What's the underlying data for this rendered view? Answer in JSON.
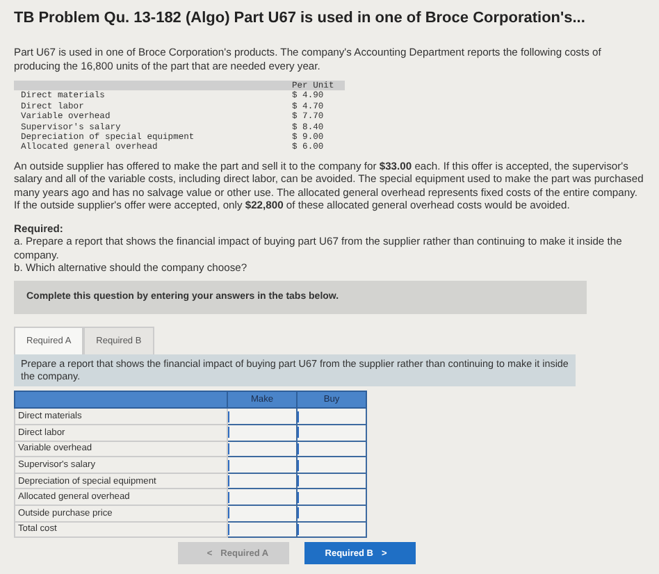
{
  "title": "TB Problem Qu. 13-182 (Algo) Part U67 is used in one of Broce Corporation's...",
  "intro": "Part U67 is used in one of Broce Corporation's products. The company's Accounting Department reports the following costs of producing the 16,800 units of the part that are needed every year.",
  "cost_table": {
    "header": "Per Unit",
    "rows": [
      {
        "label": "Direct materials",
        "value": "$ 4.90"
      },
      {
        "label": "Direct labor",
        "value": "$ 4.70"
      },
      {
        "label": "Variable overhead",
        "value": "$ 7.70"
      },
      {
        "label": "Supervisor's salary",
        "value": "$ 8.40"
      },
      {
        "label": "Depreciation of special equipment",
        "value": "$ 9.00"
      },
      {
        "label": "Allocated general overhead",
        "value": "$ 6.00"
      }
    ]
  },
  "offer": "An outside supplier has offered to make the part and sell it to the company for **$33.00** each. If this offer is accepted, the supervisor's salary and all of the variable costs, including direct labor, can be avoided. The special equipment used to make the part was purchased many years ago and has no salvage value or other use. The allocated general overhead represents fixed costs of the entire company. If the outside supplier's offer were accepted, only **$22,800** of these allocated general overhead costs would be avoided.",
  "required": {
    "heading": "Required:",
    "items": [
      "a. Prepare a report that shows the financial impact of buying part U67 from the supplier rather than continuing to make it inside the company.",
      "b. Which alternative should the company choose?"
    ]
  },
  "banner": "Complete this question by entering your answers in the tabs below.",
  "tabs": [
    {
      "label": "Required A",
      "selected": true
    },
    {
      "label": "Required B",
      "selected": false
    }
  ],
  "instruction": "Prepare a report that shows the financial impact of buying part U67 from the supplier rather than continuing to make it inside the company.",
  "report": {
    "columns": [
      "Make",
      "Buy"
    ],
    "rows": [
      "Direct materials",
      "Direct labor",
      "Variable overhead",
      "Supervisor's salary",
      "Depreciation of special equipment",
      "Allocated general overhead",
      "Outside purchase price",
      "Total cost"
    ]
  },
  "nav": [
    {
      "kind": "prev",
      "label": "Required A",
      "arrow": "<",
      "disabled": true
    },
    {
      "kind": "next",
      "label": "Required B",
      "arrow": ">",
      "disabled": false
    }
  ]
}
